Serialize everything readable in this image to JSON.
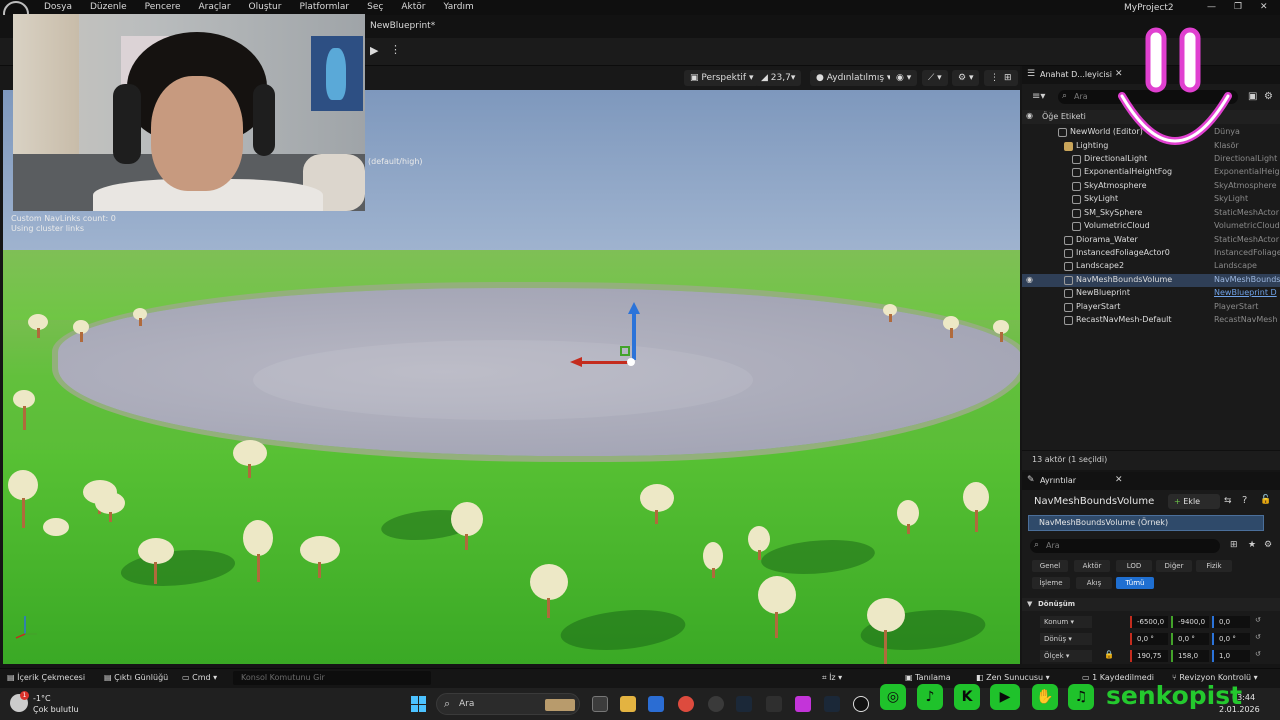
{
  "menu": {
    "items": [
      "Dosya",
      "Düzenle",
      "Pencere",
      "Araçlar",
      "Oluştur",
      "Platformlar",
      "Seç",
      "Aktör",
      "Yardım"
    ],
    "project": "MyProject2"
  },
  "tab": {
    "blueprint": "NewBlueprint*"
  },
  "viewport": {
    "perspective": "Perspektif",
    "fov": "23,7",
    "lighting": "Aydınlatılmış",
    "stats_line1": "Custom NavLinks count: 0",
    "stats_line2": "Using cluster links",
    "lod_text": "(default/high)"
  },
  "outliner": {
    "tab_title": "Anahat D...leyicisi",
    "search_placeholder": "Ara",
    "column_label": "Öğe Etiketi",
    "rows": [
      {
        "name": "NewWorld (Editor)",
        "type": "Dünya"
      },
      {
        "name": "Lighting",
        "type": "Klasör"
      },
      {
        "name": "DirectionalLight",
        "type": "DirectionalLight"
      },
      {
        "name": "ExponentialHeightFog",
        "type": "ExponentialHeigh"
      },
      {
        "name": "SkyAtmosphere",
        "type": "SkyAtmosphere"
      },
      {
        "name": "SkyLight",
        "type": "SkyLight"
      },
      {
        "name": "SM_SkySphere",
        "type": "StaticMeshActor"
      },
      {
        "name": "VolumetricCloud",
        "type": "VolumetricCloud"
      },
      {
        "name": "Diorama_Water",
        "type": "StaticMeshActor"
      },
      {
        "name": "InstancedFoliageActor0",
        "type": "InstancedFoliage"
      },
      {
        "name": "Landscape2",
        "type": "Landscape"
      },
      {
        "name": "NavMeshBoundsVolume",
        "type": "NavMeshBounds"
      },
      {
        "name": "NewBlueprint",
        "type": "NewBlueprint D"
      },
      {
        "name": "PlayerStart",
        "type": "PlayerStart"
      },
      {
        "name": "RecastNavMesh-Default",
        "type": "RecastNavMesh"
      }
    ],
    "footer": "13 aktör (1 seçildi)"
  },
  "details": {
    "tab_title": "Ayrıntılar",
    "title": "NavMeshBoundsVolume",
    "add_label": "Ekle",
    "component": "NavMeshBoundsVolume (Örnek)",
    "search_placeholder": "Ara",
    "filters": [
      "Genel",
      "Aktör",
      "LOD",
      "Diğer",
      "Fizik",
      "İşleme",
      "Akış",
      "Tümü"
    ],
    "section": "Dönüşüm",
    "props": [
      {
        "label": "Konum",
        "x": "-6500,0",
        "y": "-9400,0",
        "z": "0,0"
      },
      {
        "label": "Dönüş",
        "x": "0,0 °",
        "y": "0,0 °",
        "z": "0,0 °"
      },
      {
        "label": "Ölçek",
        "x": "190,75",
        "y": "158,0",
        "z": "1,0"
      }
    ]
  },
  "statusbar": {
    "content_drawer": "İçerik Çekmecesi",
    "output_log": "Çıktı Günlüğü",
    "cmd": "Cmd",
    "console_placeholder": "Konsol Komutunu Gir",
    "trace": "İz",
    "derive": "Tanılama",
    "zen": "Zen Sunucusu",
    "saved": "1 Kaydedilmedi",
    "revision": "Revizyon Kontrolü"
  },
  "taskbar": {
    "temp": "-1°C",
    "weather": "Çok bulutlu",
    "search_placeholder": "Ara",
    "time": "03:44",
    "date": "2.01.2026",
    "notification_count": "1"
  },
  "overlay": {
    "channel": "senkopist"
  },
  "colors": {
    "accent": "#1f6fd1",
    "selection": "#2f3f57",
    "overlay_green": "#24c92e",
    "smiley": "#e040d0"
  }
}
